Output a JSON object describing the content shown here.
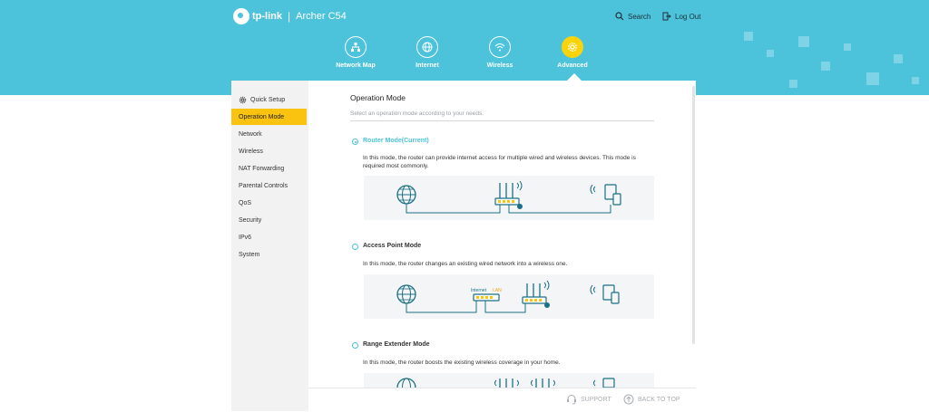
{
  "brand": {
    "logo": "tp-link",
    "separator": "|",
    "model": "Archer C54"
  },
  "header": {
    "search_label": "Search",
    "logout_label": "Log Out"
  },
  "nav": [
    {
      "label": "Network Map",
      "icon": "network-map-icon"
    },
    {
      "label": "Internet",
      "icon": "globe-icon"
    },
    {
      "label": "Wireless",
      "icon": "wifi-icon"
    },
    {
      "label": "Advanced",
      "icon": "gear-icon",
      "active": true
    }
  ],
  "sidebar": {
    "items": [
      {
        "label": "Quick Setup",
        "icon": "gear-icon"
      },
      {
        "label": "Operation Mode",
        "active": true
      },
      {
        "label": "Network"
      },
      {
        "label": "Wireless"
      },
      {
        "label": "NAT Forwarding"
      },
      {
        "label": "Parental Controls"
      },
      {
        "label": "QoS"
      },
      {
        "label": "Security"
      },
      {
        "label": "IPv6"
      },
      {
        "label": "System"
      }
    ]
  },
  "page": {
    "title": "Operation Mode",
    "subtitle": "Select an operation mode according to your needs."
  },
  "modes": [
    {
      "label": "Router Mode(Current)",
      "selected": true,
      "description": "In this mode, the router can provide internet access for multiple wired and wireless devices. This mode is required most commonly."
    },
    {
      "label": "Access Point Mode",
      "selected": false,
      "description": "In this mode, the router changes an existing wired network into a wireless one.",
      "diagram_labels": {
        "internet": "Internet",
        "lan": "LAN"
      }
    },
    {
      "label": "Range Extender Mode",
      "selected": false,
      "description": "In this mode, the router boosts the existing wireless coverage in your home."
    }
  ],
  "footer": {
    "support_label": "SUPPORT",
    "back_to_top_label": "BACK TO TOP"
  },
  "colors": {
    "header": "#4cc3da",
    "accent_yellow": "#f9c30f",
    "teal": "#4cc3da",
    "line_dark": "#1b6f86"
  }
}
